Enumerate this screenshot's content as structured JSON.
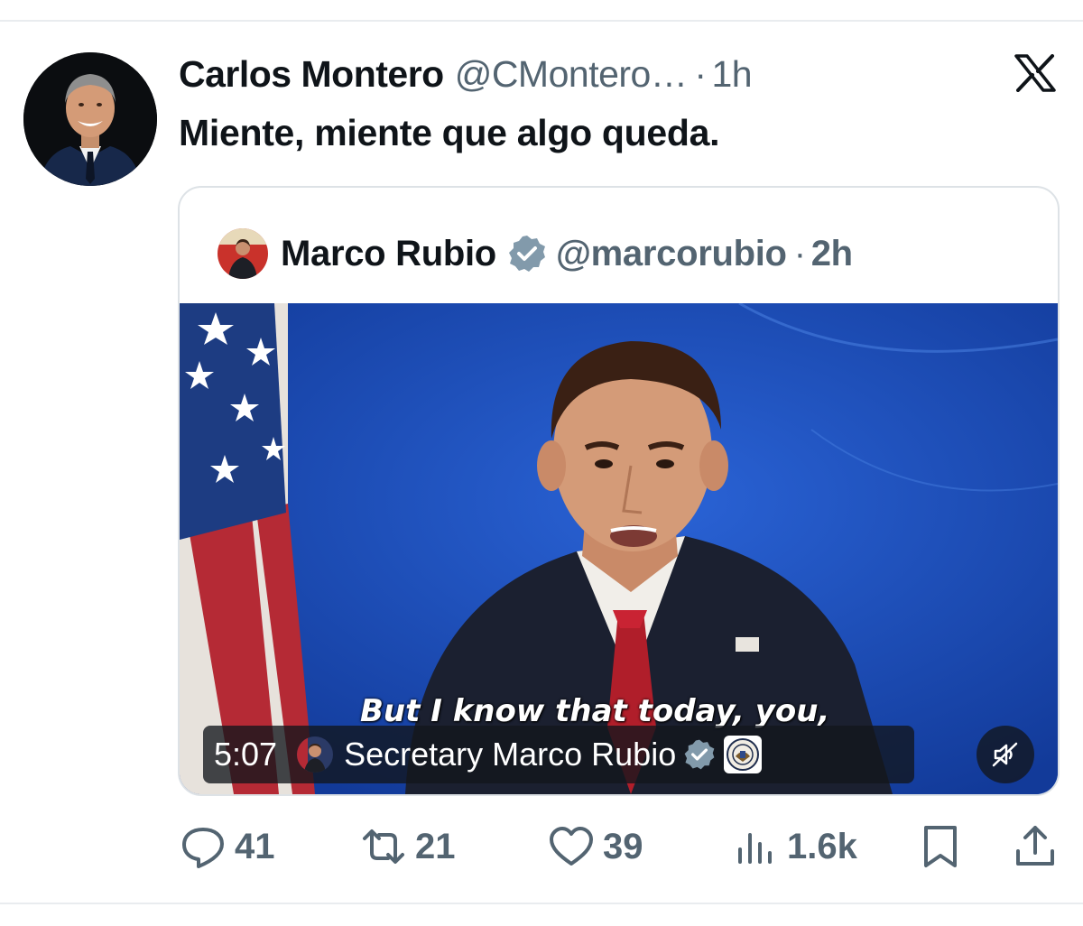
{
  "tweet": {
    "author_name": "Carlos Montero",
    "author_handle": "@CMontero…",
    "separator": "·",
    "time": "1h",
    "text": "Miente, miente que algo queda."
  },
  "quoted": {
    "author_name": "Marco Rubio",
    "author_handle": "@marcorubio",
    "separator": "·",
    "time": "2h",
    "verified": true,
    "video": {
      "caption": "But I know that today, you,",
      "duration": "5:07",
      "channel_name": "Secretary Marco Rubio",
      "muted": true
    }
  },
  "actions": {
    "replies": "41",
    "reposts": "21",
    "likes": "39",
    "views": "1.6k"
  },
  "icons": {
    "platform": "x-logo-icon",
    "reply": "reply-icon",
    "repost": "repost-icon",
    "like": "heart-icon",
    "views": "views-icon",
    "bookmark": "bookmark-icon",
    "share": "share-icon",
    "mute": "muted-speaker-icon"
  },
  "colors": {
    "text_primary": "#0f1419",
    "text_secondary": "#536471",
    "verified_badge": "#829aab",
    "video_background": "#1b4fbd"
  }
}
